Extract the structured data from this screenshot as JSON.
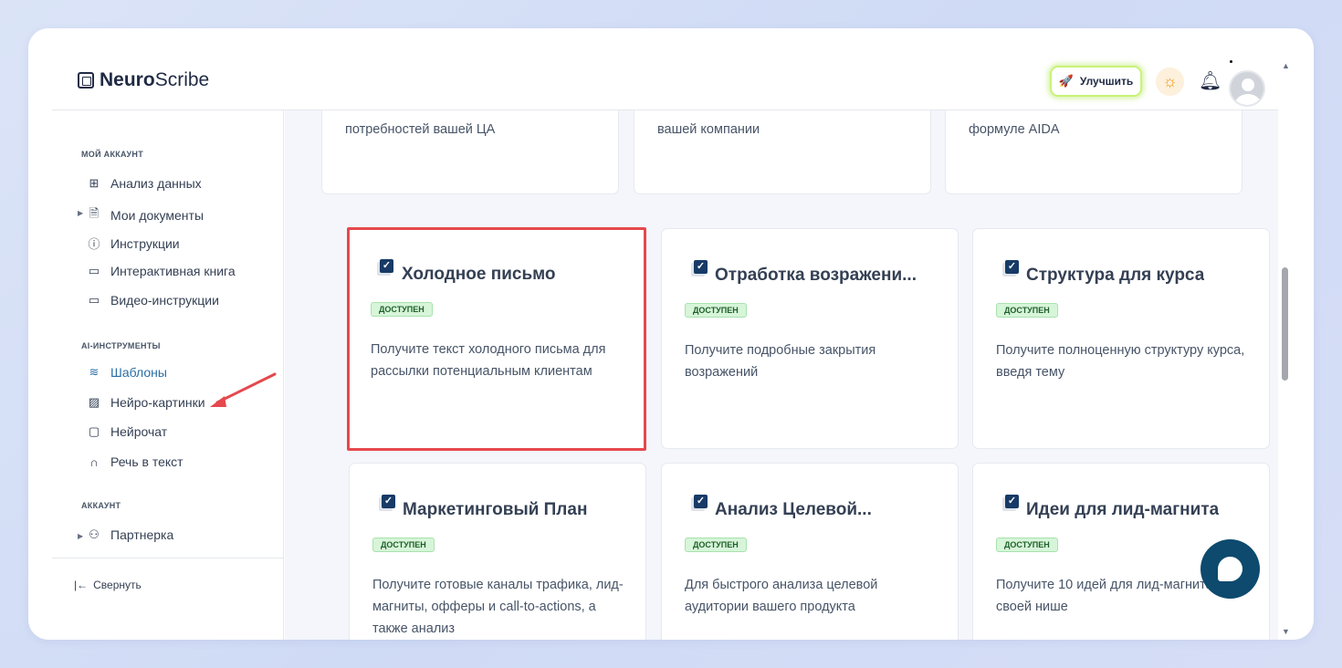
{
  "brand": {
    "name_bold": "Neuro",
    "name_light": "Scribe"
  },
  "header": {
    "upgrade_label": "Улучшить"
  },
  "sidebar": {
    "sections": {
      "my_account": "МОЙ АККАУНТ",
      "ai_tools": "AI-ИНСТРУМЕНТЫ",
      "account": "АККАУНТ"
    },
    "items": {
      "data_analysis": "Анализ данных",
      "my_documents": "Мои документы",
      "instructions": "Инструкции",
      "interactive_book": "Интерактивная книга",
      "video_instructions": "Видео-инструкции",
      "templates": "Шаблоны",
      "neuro_images": "Нейро-картинки",
      "neuro_chat": "Нейрочат",
      "speech_to_text": "Речь в текст",
      "partner": "Партнерка"
    },
    "collapse_label": "Свернуть"
  },
  "cards_top": [
    {
      "desc": "потребностей вашей ЦА"
    },
    {
      "desc": "вашей компании"
    },
    {
      "desc": "формуле AIDA"
    }
  ],
  "cards": [
    {
      "title": "Холодное письмо",
      "badge": "доступен",
      "desc": "Получите текст холодного письма для рассылки потенциальным клиентам"
    },
    {
      "title": "Отработка возражени...",
      "badge": "доступен",
      "desc": "Получите подробные закрытия возражений"
    },
    {
      "title": "Структура для курса",
      "badge": "доступен",
      "desc": "Получите полноценную структуру курса, введя тему"
    },
    {
      "title": "Маркетинговый План",
      "badge": "доступен",
      "desc": "Получите готовые каналы трафика, лид-магниты, офферы и call-to-actions, а также анализ"
    },
    {
      "title": "Анализ Целевой...",
      "badge": "доступен",
      "desc": "Для быстрого анализа целевой аудитории вашего продукта"
    },
    {
      "title": "Идеи для лид-магнита",
      "badge": "доступен",
      "desc": "Получите 10 идей для лид-магнита в своей нише"
    }
  ],
  "colors": {
    "accent": "#2a6fa7",
    "highlight": "#e5484d",
    "badge_bg": "#d7f5d9",
    "chat": "#0d4a6e"
  }
}
